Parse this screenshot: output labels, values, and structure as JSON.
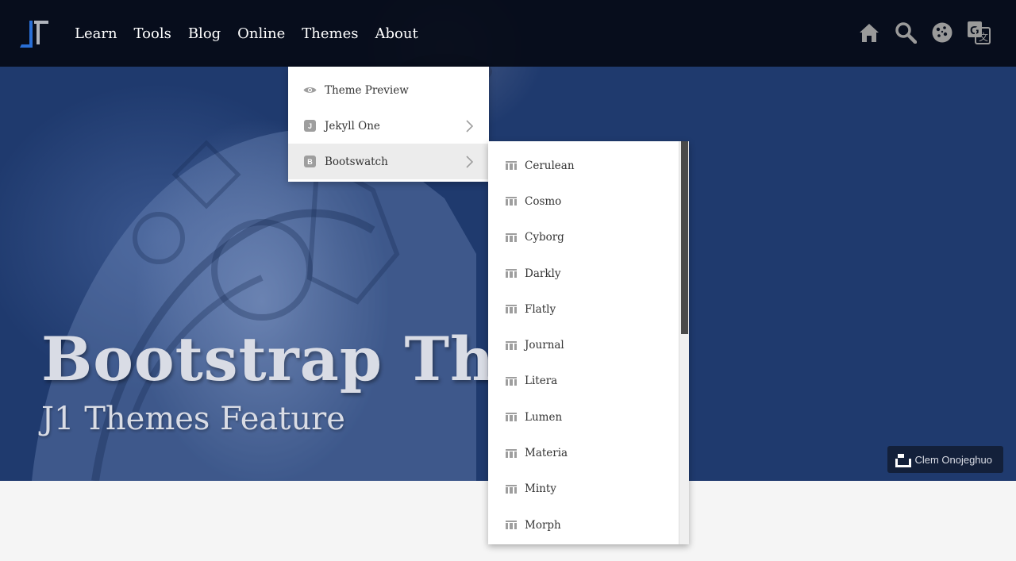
{
  "nav": {
    "links": [
      "Learn",
      "Tools",
      "Blog",
      "Online",
      "Themes",
      "About"
    ],
    "icons": [
      "home-icon",
      "search-icon",
      "cookie-icon",
      "translate-icon"
    ]
  },
  "hero": {
    "title": "Bootstrap The",
    "subtitle": "J1 Themes Feature",
    "credit": "Clem Onojeghuo"
  },
  "dropdown": {
    "items": [
      {
        "label": "Theme Preview",
        "icon": "eye-icon"
      },
      {
        "label": "Jekyll One",
        "badge": "J",
        "has_submenu": true
      },
      {
        "label": "Bootswatch",
        "badge": "B",
        "has_submenu": true,
        "active": true
      }
    ]
  },
  "submenu": {
    "items": [
      "Cerulean",
      "Cosmo",
      "Cyborg",
      "Darkly",
      "Flatly",
      "Journal",
      "Litera",
      "Lumen",
      "Materia",
      "Minty",
      "Morph"
    ]
  },
  "colors": {
    "hero_bg": "#1f3a6e",
    "navbar_bg": "#050a16",
    "logo_blue": "#2a6fd6"
  }
}
